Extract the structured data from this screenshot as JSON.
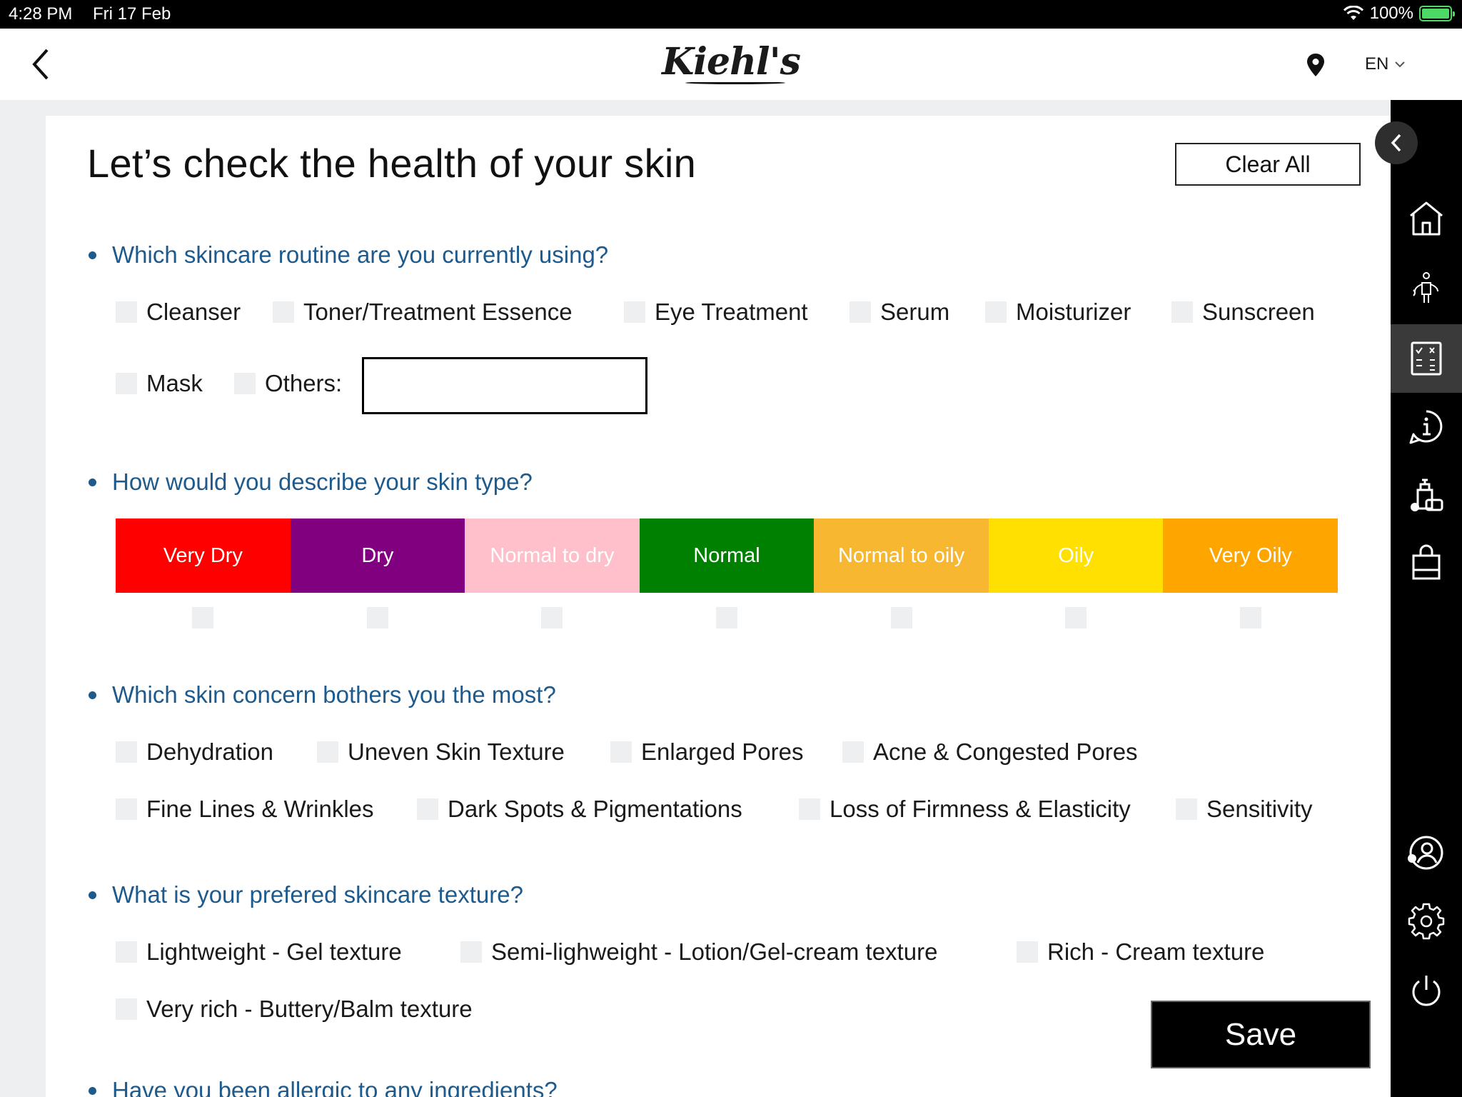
{
  "status_bar": {
    "time": "4:28 PM",
    "date": "Fri 17 Feb",
    "battery": "100%"
  },
  "header": {
    "logo": "Kiehl's",
    "language": "EN"
  },
  "page": {
    "title": "Let’s check the health of your skin",
    "clear_all": "Clear All",
    "save": "Save"
  },
  "routine": {
    "question": "Which skincare routine are you currently using?",
    "options": [
      "Cleanser",
      "Toner/Treatment Essence",
      "Eye Treatment",
      "Serum",
      "Moisturizer",
      "Sunscreen",
      "Mask",
      "Others:"
    ],
    "others_value": ""
  },
  "skin_type": {
    "question": "How would you describe your skin type?",
    "options": [
      {
        "label": "Very Dry",
        "color": "#ff0000"
      },
      {
        "label": "Dry",
        "color": "#800080"
      },
      {
        "label": "Normal to dry",
        "color": "#ffc0cb"
      },
      {
        "label": "Normal",
        "color": "#008000"
      },
      {
        "label": "Normal to oily",
        "color": "#f7b731"
      },
      {
        "label": "Oily",
        "color": "#ffe000"
      },
      {
        "label": "Very Oily",
        "color": "#ffa500"
      }
    ]
  },
  "concern": {
    "question": "Which skin concern bothers you the most?",
    "options": [
      "Dehydration",
      "Uneven Skin Texture",
      "Enlarged Pores",
      "Acne & Congested Pores",
      "Fine Lines & Wrinkles",
      "Dark Spots & Pigmentations",
      "Loss of Firmness & Elasticity",
      "Sensitivity"
    ]
  },
  "texture": {
    "question": "What is your prefered skincare texture?",
    "options": [
      "Lightweight - Gel texture",
      "Semi-lighweight - Lotion/Gel-cream texture",
      "Rich - Cream texture",
      "Very rich - Buttery/Balm texture"
    ]
  },
  "allergy": {
    "question": "Have you been allergic to any ingredients?"
  },
  "sidebar": {
    "icons": [
      "home-icon",
      "body-diagnosis-icon",
      "skin-checklist-icon",
      "info-icon",
      "products-icon",
      "shopping-bag-icon",
      "user-profile-icon",
      "settings-icon",
      "power-icon"
    ],
    "active": "skin-checklist-icon"
  },
  "colors": {
    "question_blue": "#1e5a8c",
    "checkbox_bg": "#eeeff1",
    "sidebar_bg": "#000000"
  }
}
